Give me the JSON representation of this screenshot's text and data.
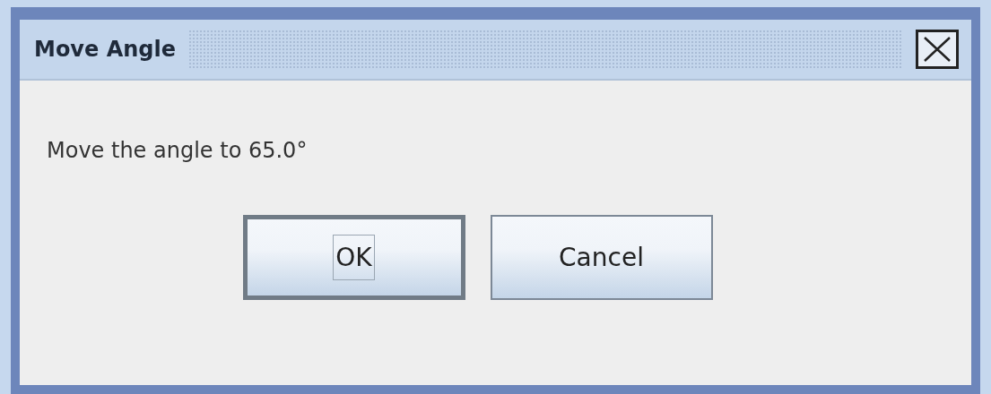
{
  "window": {
    "title": "Move Angle"
  },
  "message": "Move the angle to 65.0°",
  "buttons": [
    {
      "label": "OK",
      "default": true,
      "focused": true
    },
    {
      "label": "Cancel",
      "default": false,
      "focused": false
    }
  ]
}
